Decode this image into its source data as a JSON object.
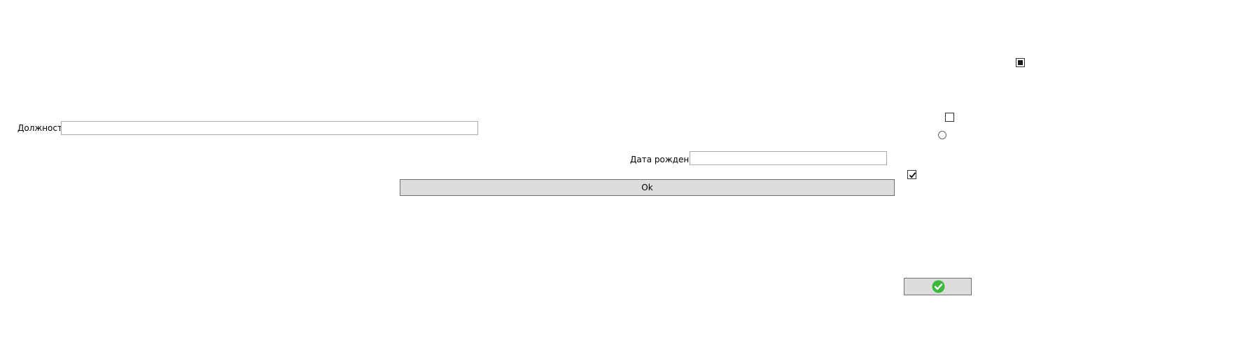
{
  "form": {
    "position_label": "Должность",
    "position_value": "",
    "birthdate_label": "Дата рождения",
    "birthdate_value": "",
    "ok_button_label": "Ok"
  },
  "controls": {
    "checkbox_top": {
      "state": "indeterminate"
    },
    "checkbox_middle": {
      "state": "unchecked"
    },
    "radio_button": {
      "state": "unchecked"
    },
    "checkbox_checked": {
      "state": "checked"
    },
    "confirm_button": {
      "icon": "check-circle-icon"
    }
  },
  "colors": {
    "button_background": "#dddddd",
    "button_border": "#707070",
    "input_border": "#a9a9a9",
    "confirm_icon": "#3cb83c"
  }
}
